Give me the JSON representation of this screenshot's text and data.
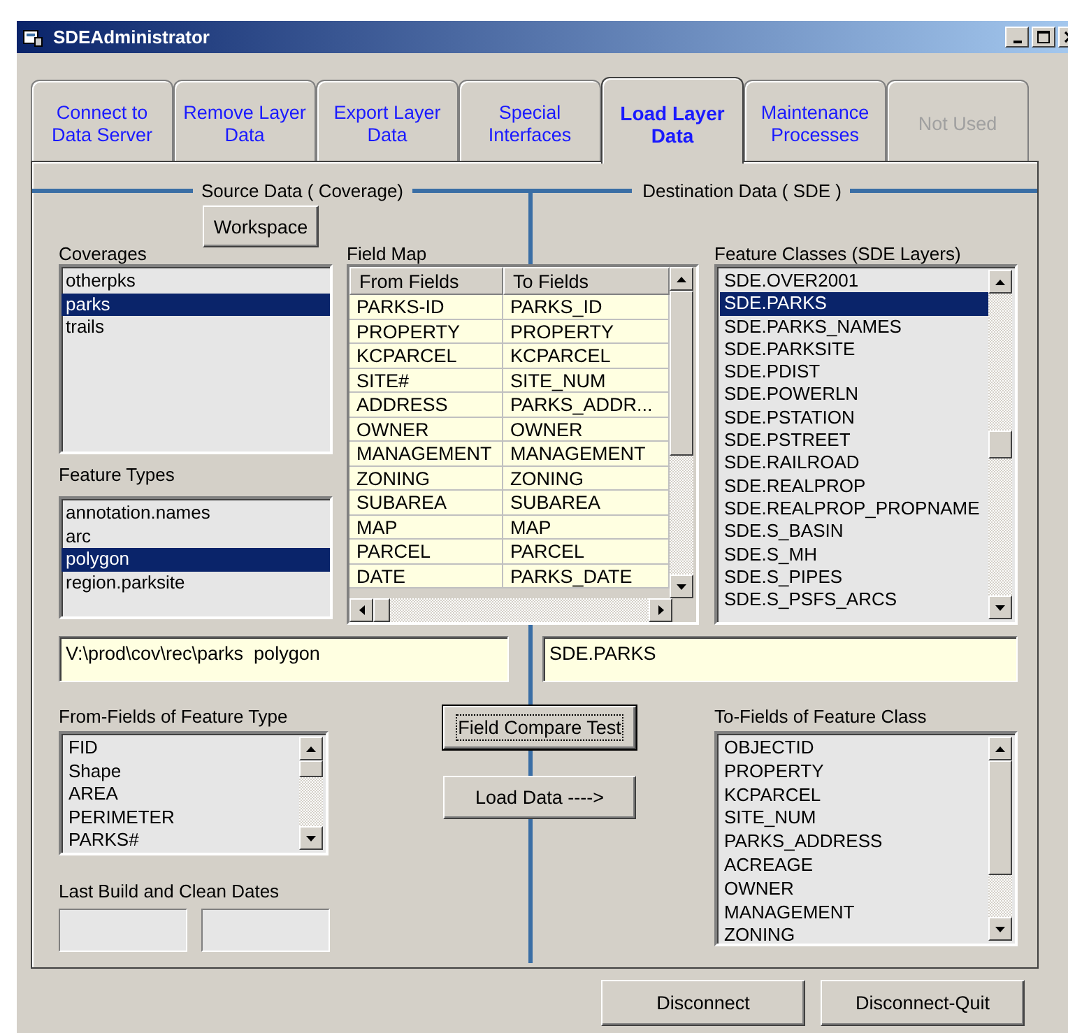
{
  "window": {
    "title": "SDEAdministrator"
  },
  "tabs": [
    {
      "label": "Connect to Data Server",
      "selected": false,
      "disabled": false
    },
    {
      "label": "Remove Layer Data",
      "selected": false,
      "disabled": false
    },
    {
      "label": "Export Layer Data",
      "selected": false,
      "disabled": false
    },
    {
      "label": "Special Interfaces",
      "selected": false,
      "disabled": false
    },
    {
      "label": "Load Layer Data",
      "selected": true,
      "disabled": false
    },
    {
      "label": "Maintenance Processes",
      "selected": false,
      "disabled": false
    },
    {
      "label": "Not Used",
      "selected": false,
      "disabled": true
    }
  ],
  "source_group": {
    "title": "Source Data ( Coverage)"
  },
  "destination_group": {
    "title": "Destination Data ( SDE )"
  },
  "workspace_button": {
    "label": "Workspace",
    "focused": false
  },
  "coverages": {
    "label": "Coverages",
    "items": [
      {
        "text": "otherpks",
        "selected": false
      },
      {
        "text": "parks",
        "selected": true
      },
      {
        "text": "trails",
        "selected": false
      }
    ]
  },
  "feature_types": {
    "label": "Feature Types",
    "items": [
      {
        "text": "annotation.names",
        "selected": false
      },
      {
        "text": "arc",
        "selected": false
      },
      {
        "text": "polygon",
        "selected": true
      },
      {
        "text": "region.parksite",
        "selected": false
      }
    ]
  },
  "field_map": {
    "label": "Field Map",
    "columns": [
      "From Fields",
      "To Fields"
    ],
    "rows": [
      [
        "PARKS-ID",
        "PARKS_ID"
      ],
      [
        "PROPERTY",
        "PROPERTY"
      ],
      [
        "KCPARCEL",
        "KCPARCEL"
      ],
      [
        "SITE#",
        "SITE_NUM"
      ],
      [
        "ADDRESS",
        "PARKS_ADDR..."
      ],
      [
        "OWNER",
        "OWNER"
      ],
      [
        "MANAGEMENT",
        "MANAGEMENT"
      ],
      [
        "ZONING",
        "ZONING"
      ],
      [
        "SUBAREA",
        "SUBAREA"
      ],
      [
        "MAP",
        "MAP"
      ],
      [
        "PARCEL",
        "PARCEL"
      ],
      [
        "DATE",
        "PARKS_DATE"
      ]
    ]
  },
  "feature_classes": {
    "label": "Feature Classes (SDE Layers)",
    "items": [
      {
        "text": "SDE.OVER2001",
        "selected": false
      },
      {
        "text": "SDE.PARKS",
        "selected": true
      },
      {
        "text": "SDE.PARKS_NAMES",
        "selected": false
      },
      {
        "text": "SDE.PARKSITE",
        "selected": false
      },
      {
        "text": "SDE.PDIST",
        "selected": false
      },
      {
        "text": "SDE.POWERLN",
        "selected": false
      },
      {
        "text": "SDE.PSTATION",
        "selected": false
      },
      {
        "text": "SDE.PSTREET",
        "selected": false
      },
      {
        "text": "SDE.RAILROAD",
        "selected": false
      },
      {
        "text": "SDE.REALPROP",
        "selected": false
      },
      {
        "text": "SDE.REALPROP_PROPNAME",
        "selected": false
      },
      {
        "text": "SDE.S_BASIN",
        "selected": false
      },
      {
        "text": "SDE.S_MH",
        "selected": false
      },
      {
        "text": "SDE.S_PIPES",
        "selected": false
      },
      {
        "text": "SDE.S_PSFS_ARCS",
        "selected": false
      }
    ]
  },
  "source_path": {
    "value": "V:\\prod\\cov\\rec\\parks  polygon"
  },
  "destination_name": {
    "value": "SDE.PARKS"
  },
  "from_fields": {
    "label": "From-Fields of Feature Type",
    "items": [
      "FID",
      "Shape",
      "AREA",
      "PERIMETER",
      "PARKS#"
    ]
  },
  "compare_button": {
    "label": "Field Compare Test",
    "focused": true
  },
  "load_button": {
    "label": "Load Data ---->",
    "focused": false
  },
  "last_build": {
    "label": "Last Build and Clean Dates"
  },
  "to_fields": {
    "label": "To-Fields of Feature Class",
    "items": [
      "OBJECTID",
      "PROPERTY",
      "KCPARCEL",
      "SITE_NUM",
      "PARKS_ADDRESS",
      "ACREAGE",
      "OWNER",
      "MANAGEMENT",
      "ZONING"
    ]
  },
  "buttons": [
    {
      "label": "Disconnect",
      "focused": false
    },
    {
      "label": "Disconnect-Quit",
      "focused": false
    }
  ]
}
